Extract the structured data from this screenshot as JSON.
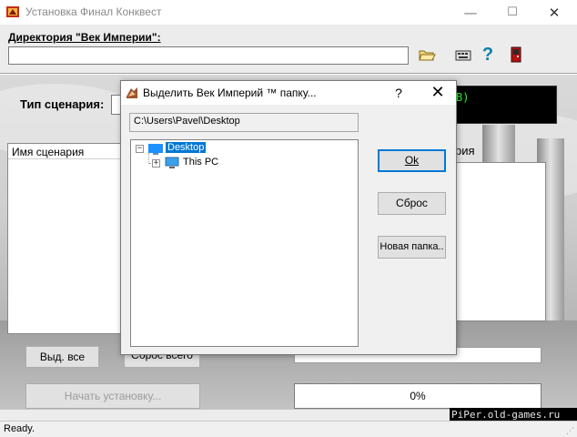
{
  "window": {
    "title": "Установка Финал Конквест",
    "controls": {
      "minimize": "—",
      "maximize": "☐",
      "close": "✕"
    }
  },
  "directory": {
    "label": "Директория \"Век Империи\":",
    "value": ""
  },
  "toolbar": {
    "icons": [
      "open-folder-icon",
      "keyboard-icon",
      "help-icon",
      "exit-icon"
    ],
    "help_glyph": "?"
  },
  "scenario": {
    "type_label": "Тип сценария:",
    "lcd_text": "B)",
    "list_header": "Имя сценария",
    "right_header": "рия"
  },
  "buttons": {
    "select_all": "Выд. все",
    "reset_all": "Сброс всего",
    "install": "Начать установку..."
  },
  "progress": {
    "percent_label": "0%",
    "value": 0
  },
  "watermark": "PiPer.old-games.ru",
  "status": {
    "text": "Ready."
  },
  "dialog": {
    "title": "Выделить Век Империй ™ папку...",
    "help": "?",
    "close": "✕",
    "path": "C:\\Users\\Pavel\\Desktop",
    "tree": [
      {
        "label": "Desktop",
        "expander": "−",
        "selected": true
      },
      {
        "label": "This PC",
        "expander": "+",
        "selected": false
      }
    ],
    "buttons": {
      "ok": "Ok",
      "reset": "Сброс",
      "new_folder": "Новая папка.."
    }
  },
  "colors": {
    "selection": "#0078d7",
    "lcd_text": "#1dff1d"
  }
}
